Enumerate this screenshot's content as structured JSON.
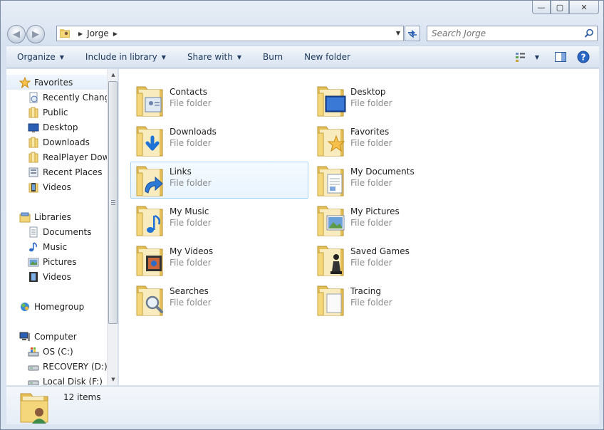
{
  "window": {
    "caption": {
      "minimize": "—",
      "maximize": "▢",
      "close": "✕"
    }
  },
  "address": {
    "path": [
      "Jorge"
    ],
    "search_placeholder": "Search Jorge"
  },
  "toolbar": {
    "organize": "Organize",
    "include_in_library": "Include in library",
    "share_with": "Share with",
    "burn": "Burn",
    "new_folder": "New folder",
    "icons": [
      "view-options-icon",
      "preview-pane-icon",
      "help-icon"
    ]
  },
  "nav": {
    "favorites": {
      "label": "Favorites",
      "items": [
        "Recently Changed",
        "Public",
        "Desktop",
        "Downloads",
        "RealPlayer Downloads",
        "Recent Places",
        "Videos"
      ]
    },
    "libraries": {
      "label": "Libraries",
      "items": [
        "Documents",
        "Music",
        "Pictures",
        "Videos"
      ]
    },
    "homegroup": {
      "label": "Homegroup"
    },
    "computer": {
      "label": "Computer",
      "items": [
        "OS (C:)",
        "RECOVERY (D:)",
        "Local Disk (F:)"
      ]
    }
  },
  "folders": [
    {
      "name": "Contacts",
      "type": "File folder",
      "overlay": "contacts",
      "selected": false
    },
    {
      "name": "Desktop",
      "type": "File folder",
      "overlay": "desktop",
      "selected": false
    },
    {
      "name": "Downloads",
      "type": "File folder",
      "overlay": "downloads",
      "selected": false
    },
    {
      "name": "Favorites",
      "type": "File folder",
      "overlay": "favorites",
      "selected": false
    },
    {
      "name": "Links",
      "type": "File folder",
      "overlay": "links",
      "selected": true
    },
    {
      "name": "My Documents",
      "type": "File folder",
      "overlay": "documents",
      "selected": false
    },
    {
      "name": "My Music",
      "type": "File folder",
      "overlay": "music",
      "selected": false
    },
    {
      "name": "My Pictures",
      "type": "File folder",
      "overlay": "pictures",
      "selected": false
    },
    {
      "name": "My Videos",
      "type": "File folder",
      "overlay": "videos",
      "selected": false
    },
    {
      "name": "Saved Games",
      "type": "File folder",
      "overlay": "games",
      "selected": false
    },
    {
      "name": "Searches",
      "type": "File folder",
      "overlay": "searches",
      "selected": false
    },
    {
      "name": "Tracing",
      "type": "File folder",
      "overlay": "blank",
      "selected": false
    }
  ],
  "status": {
    "count": "12 items"
  },
  "colors": {
    "folder": "#f3d77a",
    "folder_dark": "#d9b34a",
    "selection": "#a7d2f4",
    "toolbar_text": "#1e395b"
  }
}
